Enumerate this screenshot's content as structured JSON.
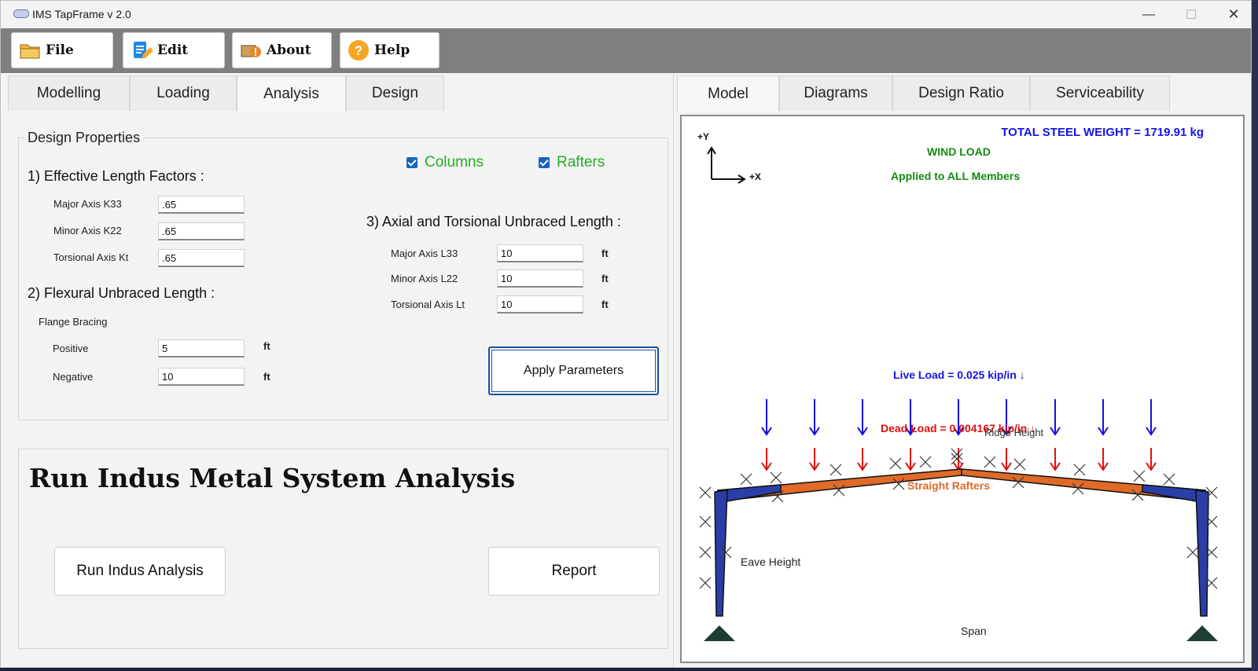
{
  "window": {
    "title": "IMS TapFrame v 2.0",
    "minimize": "—",
    "maximize": "☐",
    "close": "✕"
  },
  "toolbar": {
    "file": "File",
    "edit": "Edit",
    "about": "About",
    "help": "Help"
  },
  "left_tabs": [
    "Modelling",
    "Loading",
    "Analysis",
    "Design"
  ],
  "right_tabs": [
    "Model",
    "Diagrams",
    "Design Ratio",
    "Serviceability"
  ],
  "design_properties": {
    "title": "Design Properties",
    "columns_label": "Columns",
    "rafters_label": "Rafters",
    "columns_checked": true,
    "rafters_checked": true,
    "eff_heading": "1) Effective Length Factors :",
    "major_k33_label": "Major Axis K33",
    "major_k33": ".65",
    "minor_k22_label": "Minor Axis K22",
    "minor_k22": ".65",
    "torsional_kt_label": "Torsional Axis Kt",
    "torsional_kt": ".65",
    "flex_heading": "2) Flexural Unbraced Length :",
    "flange_label": "Flange Bracing",
    "positive_label": "Positive",
    "positive": "5",
    "negative_label": "Negative",
    "negative": "10",
    "axial_heading": "3) Axial and Torsional Unbraced Length :",
    "major_l33_label": "Major Axis L33",
    "major_l33": "10",
    "minor_l22_label": "Minor Axis L22",
    "minor_l22": "10",
    "torsional_lt_label": "Torsional Axis Lt",
    "torsional_lt": "10",
    "unit": "ft",
    "apply_button": "Apply Parameters"
  },
  "run_section": {
    "title": "Run Indus Metal System Analysis",
    "run_button": "Run Indus Analysis",
    "report_button": "Report"
  },
  "model_view": {
    "total_weight": "TOTAL STEEL WEIGHT = 1719.91 kg",
    "wind_load": "WIND LOAD",
    "applied": "Applied to ALL Members",
    "axis_y": "+Y",
    "axis_x": "+X",
    "live_load": "Live Load = 0.025 kip/in ↓",
    "dead_load": "Dead Load = 0.004167 kip/in ↓",
    "ridge_height": "Ridge Height",
    "straight_rafters": "Straight Rafters",
    "eave_height": "Eave Height",
    "span": "Span",
    "colors": {
      "live": "#1010e0",
      "dead": "#e01010",
      "column": "#2a3ea8",
      "rafter": "#e06a28",
      "support": "#1f3d33"
    }
  }
}
